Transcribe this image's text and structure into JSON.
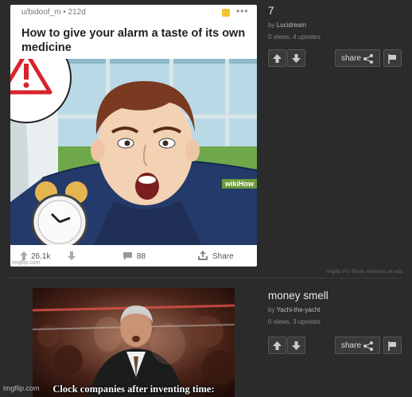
{
  "posts": [
    {
      "title": "7",
      "by_prefix": "by",
      "author": "Lucidream",
      "stats": "0 views, 4 upvotes",
      "share_label": "share",
      "meme": {
        "header": "u/bidoof_m • 212d",
        "title": "How to give your alarm a taste of its own medicine",
        "watermark": "wikiHow",
        "upvotes": "26.1k",
        "comments": "88",
        "share": "Share",
        "tag": "imgflip.com"
      }
    },
    {
      "title": "money smell",
      "by_prefix": "by",
      "author": "Yachi-the-yacht",
      "stats": "0 views, 3 upvotes",
      "share_label": "share",
      "meme": {
        "caption": "Clock companies after inventing time:",
        "watermark": "imgflip.com"
      }
    }
  ],
  "footnote": "Imgflip Pro Basic removes all ads",
  "colors": {
    "background": "#2b2b2b",
    "button": "#3a3a3a",
    "warning_red": "#d9222a",
    "wikihow_green": "#6b9b3a"
  }
}
